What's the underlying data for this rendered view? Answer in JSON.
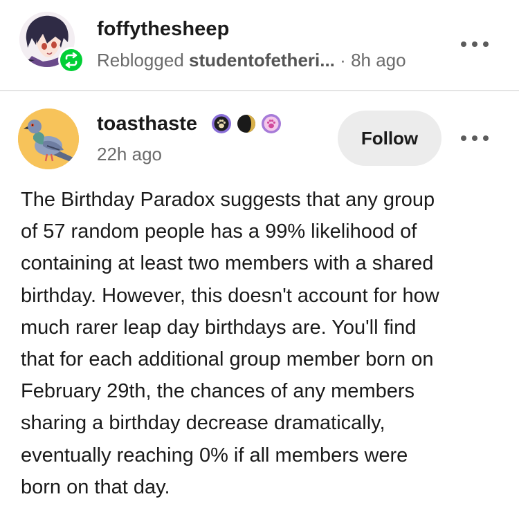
{
  "reblog": {
    "username": "foffythesheep",
    "reblogged_label": "Reblogged",
    "source_user": "studentofetheri...",
    "separator": "·",
    "time": "8h ago",
    "avatar_icon": "anime-character-avatar",
    "badge_icon": "reblog-icon",
    "badge_color": "#01cf35"
  },
  "post": {
    "username": "toasthaste",
    "badges": [
      "paw-badge-icon",
      "moon-badge-icon",
      "pink-paw-badge-icon"
    ],
    "time": "22h ago",
    "follow_label": "Follow",
    "avatar_icon": "pigeon-avatar",
    "avatar_bg": "#f7c35a",
    "body_lines": [
      "The Birthday Paradox suggests that any group",
      "of 57 random people has a 99% likelihood of",
      "containing at least two members with a shared",
      "birthday. However, this doesn't account for how",
      "much rarer leap day birthdays are. You'll find",
      "that for each additional group member born on",
      "February 29th, the chances of any members",
      "sharing a birthday decrease dramatically,",
      "eventually reaching 0% if all members were",
      "born on that day."
    ]
  }
}
